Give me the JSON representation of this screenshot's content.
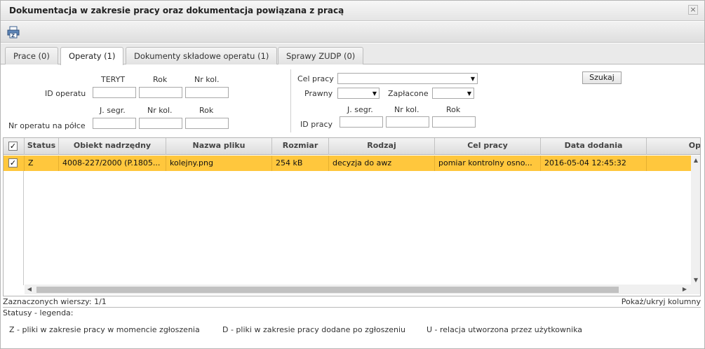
{
  "window": {
    "title": "Dokumentacja w zakresie pracy oraz dokumentacja powiązana z pracą",
    "close_glyph": "×"
  },
  "tabs": [
    {
      "label": "Prace (0)"
    },
    {
      "label": "Operaty (1)"
    },
    {
      "label": "Dokumenty składowe operatu (1)"
    },
    {
      "label": "Sprawy ZUDP (0)"
    }
  ],
  "filter": {
    "id_operatu": {
      "label": "ID operatu",
      "headers": [
        "TERYT",
        "Rok",
        "Nr kol."
      ],
      "values": [
        "",
        "",
        ""
      ]
    },
    "nr_operatu": {
      "label": "Nr operatu na półce",
      "headers": [
        "J. segr.",
        "Nr kol.",
        "Rok"
      ],
      "values": [
        "",
        "",
        ""
      ]
    },
    "cel_pracy": {
      "label": "Cel pracy",
      "value": ""
    },
    "prawny": {
      "label": "Prawny",
      "value": ""
    },
    "zaplacone": {
      "label": "Zapłacone",
      "value": ""
    },
    "id_pracy": {
      "label": "ID pracy",
      "headers": [
        "J. segr.",
        "Nr kol.",
        "Rok"
      ],
      "values": [
        "",
        "",
        ""
      ]
    },
    "search_label": "Szukaj"
  },
  "grid": {
    "header_check": "✓",
    "columns": [
      "Status",
      "Obiekt nadrzędny",
      "Nazwa pliku",
      "Rozmiar",
      "Rodzaj",
      "Cel pracy",
      "Data dodania",
      "Op"
    ],
    "rows": [
      {
        "check": "✓",
        "status": "Z",
        "obiekt": "4008-227/2000 (P.1805...",
        "nazwa": "kolejny.png",
        "rozmiar": "254 kB",
        "rodzaj": "decyzja do awz",
        "cel": "pomiar kontrolny osno...",
        "data": "2016-05-04 12:45:32"
      }
    ]
  },
  "footer": {
    "selected": "Zaznaczonych wierszy: 1/1",
    "toggle_columns": "Pokaż/ukryj kolumny"
  },
  "legend": {
    "title": "Statusy - legenda:",
    "items": [
      "Z - pliki w zakresie pracy w momencie zgłoszenia",
      "D - pliki w zakresie pracy dodane po zgłoszeniu",
      "U - relacja utworzona przez użytkownika"
    ]
  },
  "icons": {
    "print": "print-icon",
    "close": "close-icon"
  }
}
